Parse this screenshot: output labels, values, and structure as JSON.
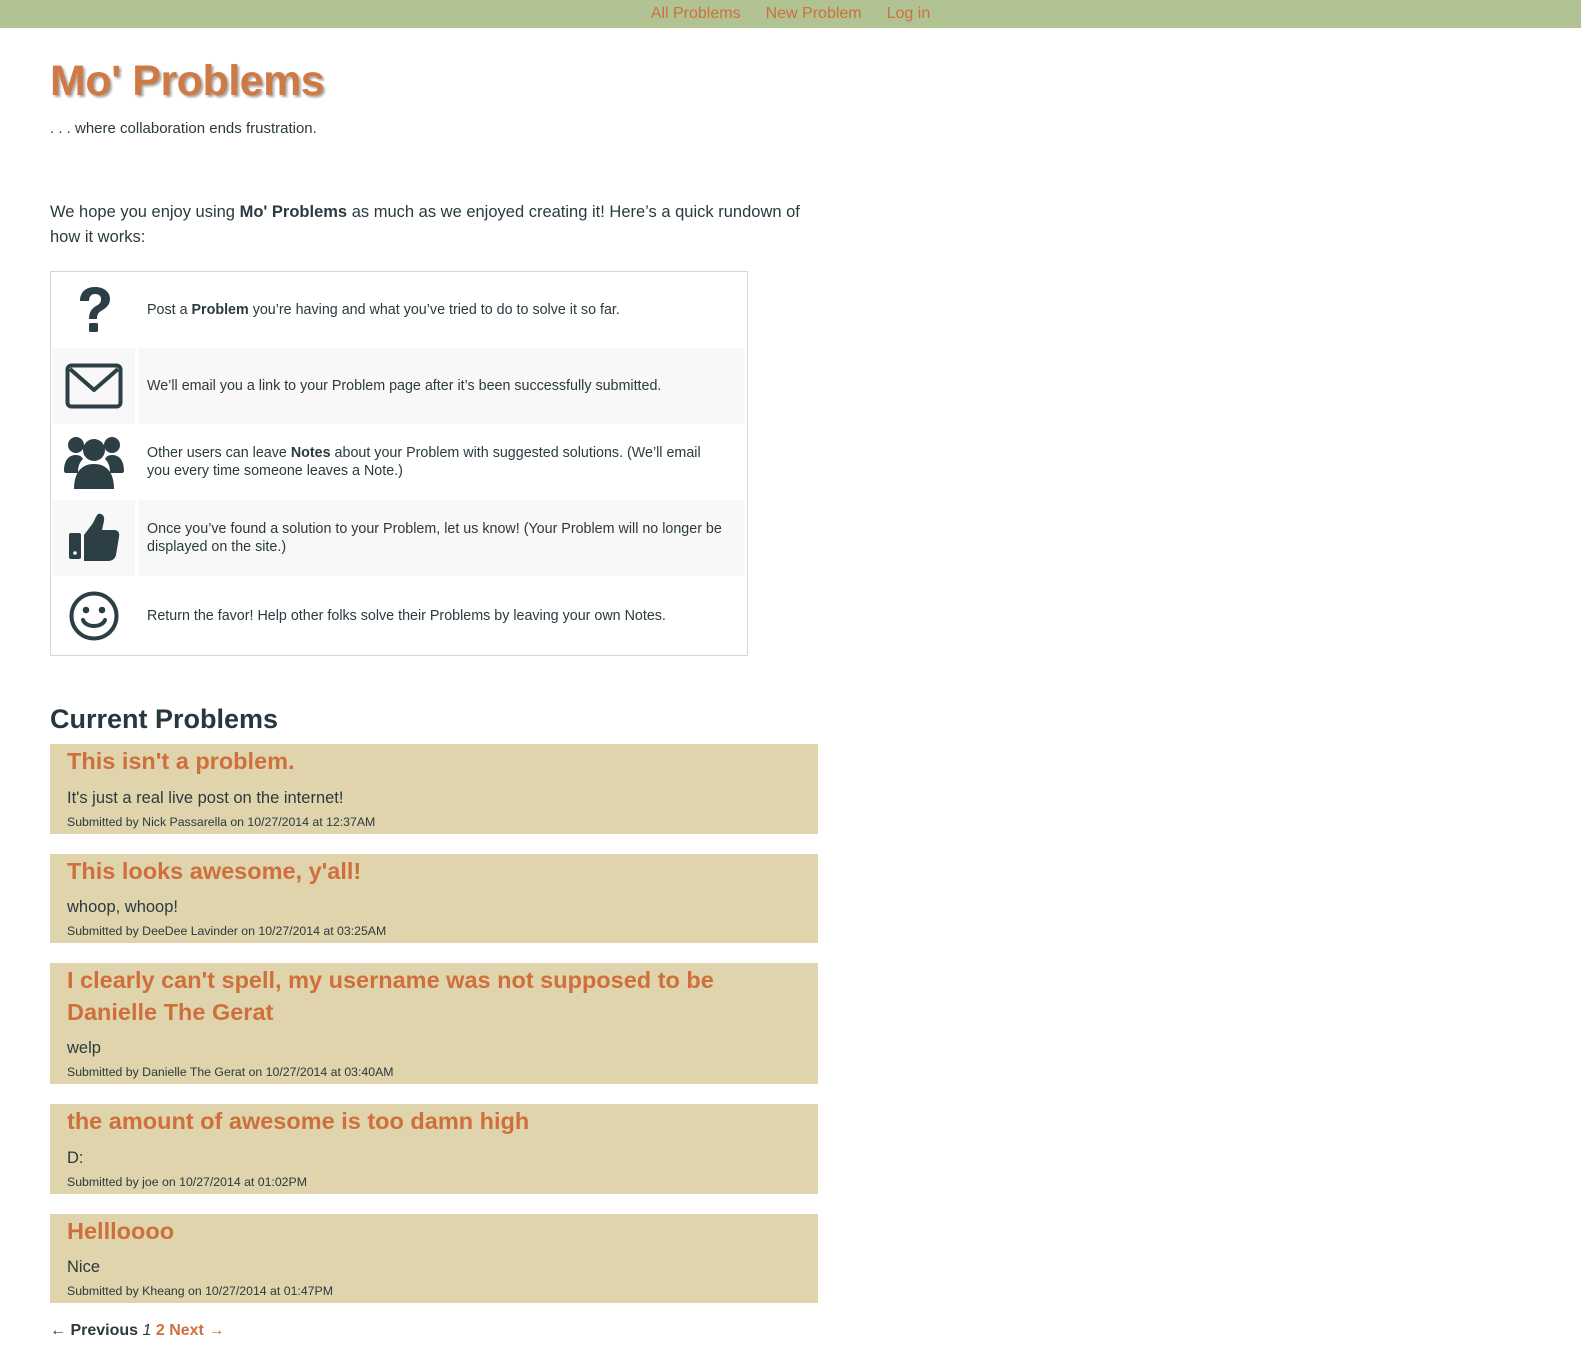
{
  "nav": {
    "links": [
      "All Problems",
      "New Problem",
      "Log in"
    ]
  },
  "header": {
    "title": "Mo' Problems",
    "tagline": ". . . where collaboration ends frustration."
  },
  "intro": {
    "before": "We hope you enjoy using ",
    "bold": "Mo' Problems",
    "after": " as much as we enjoyed creating it! Here’s a quick rundown of how it works:"
  },
  "steps": [
    {
      "icon": "question-icon",
      "before": "Post a ",
      "bold": "Problem",
      "after": " you’re having and what you’ve tried to do to solve it so far."
    },
    {
      "icon": "envelope-icon",
      "before": "We’ll email you a link to your Problem page after it’s been successfully submitted.",
      "bold": "",
      "after": ""
    },
    {
      "icon": "users-icon",
      "before": "Other users can leave ",
      "bold": "Notes",
      "after": " about your Problem with suggested solutions. (We’ll email you every time someone leaves a Note.)"
    },
    {
      "icon": "thumbs-up-icon",
      "before": "Once you’ve found a solution to your Problem, let us know! (Your Problem will no longer be displayed on the site.)",
      "bold": "",
      "after": ""
    },
    {
      "icon": "smile-icon",
      "before": "Return the favor! Help other folks solve their Problems by leaving your own Notes.",
      "bold": "",
      "after": ""
    }
  ],
  "current": {
    "heading": "Current Problems",
    "problems": [
      {
        "title": "This isn't a problem.",
        "body": "It's just a real live post on the internet!",
        "meta": "Submitted by Nick Passarella on 10/27/2014 at 12:37AM"
      },
      {
        "title": "This looks awesome, y'all!",
        "body": "whoop, whoop!",
        "meta": "Submitted by DeeDee Lavinder on 10/27/2014 at 03:25AM"
      },
      {
        "title": "I clearly can't spell, my username was not supposed to be Danielle The Gerat",
        "body": "welp",
        "meta": "Submitted by Danielle The Gerat on 10/27/2014 at 03:40AM"
      },
      {
        "title": "the amount of awesome is too damn high",
        "body": "D:",
        "meta": "Submitted by joe on 10/27/2014 at 01:02PM"
      },
      {
        "title": "Hellloooo",
        "body": "Nice",
        "meta": "Submitted by Kheang on 10/27/2014 at 01:47PM"
      }
    ]
  },
  "pager": {
    "previous": "← Previous",
    "current": "1",
    "page2": "2",
    "next": "Next →"
  },
  "colors": {
    "topbar": "#b1c393",
    "accent": "#cf6f3c",
    "card": "#dfd4ab",
    "icon": "#2b3f44"
  }
}
